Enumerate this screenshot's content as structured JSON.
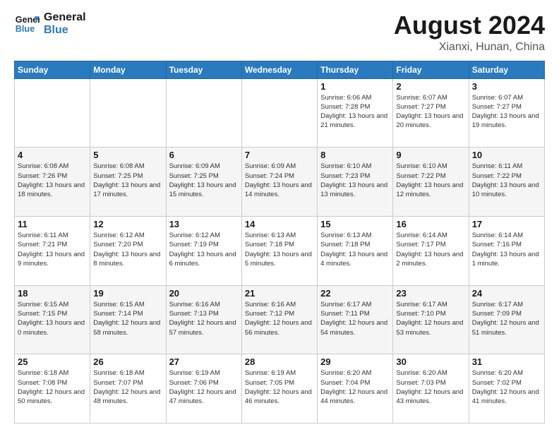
{
  "logo": {
    "line1": "General",
    "line2": "Blue"
  },
  "header": {
    "title": "August 2024",
    "subtitle": "Xianxi, Hunan, China"
  },
  "weekdays": [
    "Sunday",
    "Monday",
    "Tuesday",
    "Wednesday",
    "Thursday",
    "Friday",
    "Saturday"
  ],
  "weeks": [
    [
      {
        "day": "",
        "info": ""
      },
      {
        "day": "",
        "info": ""
      },
      {
        "day": "",
        "info": ""
      },
      {
        "day": "",
        "info": ""
      },
      {
        "day": "1",
        "info": "Sunrise: 6:06 AM\nSunset: 7:28 PM\nDaylight: 13 hours\nand 21 minutes."
      },
      {
        "day": "2",
        "info": "Sunrise: 6:07 AM\nSunset: 7:27 PM\nDaylight: 13 hours\nand 20 minutes."
      },
      {
        "day": "3",
        "info": "Sunrise: 6:07 AM\nSunset: 7:27 PM\nDaylight: 13 hours\nand 19 minutes."
      }
    ],
    [
      {
        "day": "4",
        "info": "Sunrise: 6:08 AM\nSunset: 7:26 PM\nDaylight: 13 hours\nand 18 minutes."
      },
      {
        "day": "5",
        "info": "Sunrise: 6:08 AM\nSunset: 7:25 PM\nDaylight: 13 hours\nand 17 minutes."
      },
      {
        "day": "6",
        "info": "Sunrise: 6:09 AM\nSunset: 7:25 PM\nDaylight: 13 hours\nand 15 minutes."
      },
      {
        "day": "7",
        "info": "Sunrise: 6:09 AM\nSunset: 7:24 PM\nDaylight: 13 hours\nand 14 minutes."
      },
      {
        "day": "8",
        "info": "Sunrise: 6:10 AM\nSunset: 7:23 PM\nDaylight: 13 hours\nand 13 minutes."
      },
      {
        "day": "9",
        "info": "Sunrise: 6:10 AM\nSunset: 7:22 PM\nDaylight: 13 hours\nand 12 minutes."
      },
      {
        "day": "10",
        "info": "Sunrise: 6:11 AM\nSunset: 7:22 PM\nDaylight: 13 hours\nand 10 minutes."
      }
    ],
    [
      {
        "day": "11",
        "info": "Sunrise: 6:11 AM\nSunset: 7:21 PM\nDaylight: 13 hours\nand 9 minutes."
      },
      {
        "day": "12",
        "info": "Sunrise: 6:12 AM\nSunset: 7:20 PM\nDaylight: 13 hours\nand 8 minutes."
      },
      {
        "day": "13",
        "info": "Sunrise: 6:12 AM\nSunset: 7:19 PM\nDaylight: 13 hours\nand 6 minutes."
      },
      {
        "day": "14",
        "info": "Sunrise: 6:13 AM\nSunset: 7:18 PM\nDaylight: 13 hours\nand 5 minutes."
      },
      {
        "day": "15",
        "info": "Sunrise: 6:13 AM\nSunset: 7:18 PM\nDaylight: 13 hours\nand 4 minutes."
      },
      {
        "day": "16",
        "info": "Sunrise: 6:14 AM\nSunset: 7:17 PM\nDaylight: 13 hours\nand 2 minutes."
      },
      {
        "day": "17",
        "info": "Sunrise: 6:14 AM\nSunset: 7:16 PM\nDaylight: 13 hours\nand 1 minute."
      }
    ],
    [
      {
        "day": "18",
        "info": "Sunrise: 6:15 AM\nSunset: 7:15 PM\nDaylight: 13 hours\nand 0 minutes."
      },
      {
        "day": "19",
        "info": "Sunrise: 6:15 AM\nSunset: 7:14 PM\nDaylight: 12 hours\nand 58 minutes."
      },
      {
        "day": "20",
        "info": "Sunrise: 6:16 AM\nSunset: 7:13 PM\nDaylight: 12 hours\nand 57 minutes."
      },
      {
        "day": "21",
        "info": "Sunrise: 6:16 AM\nSunset: 7:12 PM\nDaylight: 12 hours\nand 56 minutes."
      },
      {
        "day": "22",
        "info": "Sunrise: 6:17 AM\nSunset: 7:11 PM\nDaylight: 12 hours\nand 54 minutes."
      },
      {
        "day": "23",
        "info": "Sunrise: 6:17 AM\nSunset: 7:10 PM\nDaylight: 12 hours\nand 53 minutes."
      },
      {
        "day": "24",
        "info": "Sunrise: 6:17 AM\nSunset: 7:09 PM\nDaylight: 12 hours\nand 51 minutes."
      }
    ],
    [
      {
        "day": "25",
        "info": "Sunrise: 6:18 AM\nSunset: 7:08 PM\nDaylight: 12 hours\nand 50 minutes."
      },
      {
        "day": "26",
        "info": "Sunrise: 6:18 AM\nSunset: 7:07 PM\nDaylight: 12 hours\nand 48 minutes."
      },
      {
        "day": "27",
        "info": "Sunrise: 6:19 AM\nSunset: 7:06 PM\nDaylight: 12 hours\nand 47 minutes."
      },
      {
        "day": "28",
        "info": "Sunrise: 6:19 AM\nSunset: 7:05 PM\nDaylight: 12 hours\nand 46 minutes."
      },
      {
        "day": "29",
        "info": "Sunrise: 6:20 AM\nSunset: 7:04 PM\nDaylight: 12 hours\nand 44 minutes."
      },
      {
        "day": "30",
        "info": "Sunrise: 6:20 AM\nSunset: 7:03 PM\nDaylight: 12 hours\nand 43 minutes."
      },
      {
        "day": "31",
        "info": "Sunrise: 6:20 AM\nSunset: 7:02 PM\nDaylight: 12 hours\nand 41 minutes."
      }
    ]
  ]
}
